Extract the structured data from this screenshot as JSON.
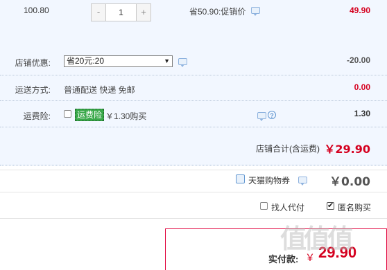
{
  "item": {
    "unit_price": "100.80",
    "quantity": "1",
    "minus": "-",
    "plus": "+",
    "promo_text": "省50.90:促销价",
    "subtotal": "49.90"
  },
  "shop_discount": {
    "label": "店铺优惠:",
    "selected_option": "省20元:20",
    "dropdown_arrow": "▼",
    "amount": "-20.00"
  },
  "shipping": {
    "label": "运送方式:",
    "method": "普通配送 快递 免邮",
    "amount": "0.00"
  },
  "freight_insurance": {
    "label": "运费险:",
    "tag": "运费险",
    "price_text": "￥1.30购买",
    "help": "?",
    "amount": "1.30"
  },
  "shop_total": {
    "label": "店铺合计(含运费)",
    "amount": "￥29.90"
  },
  "coupon": {
    "label": "天猫购物券",
    "amount": "￥0.00"
  },
  "options": {
    "proxy_pay": "找人代付",
    "anonymous": "匿名购买"
  },
  "payment": {
    "label": "实付款:",
    "currency": "￥",
    "amount": "29.90"
  },
  "watermark": "值值值",
  "colors": {
    "accent_red": "#d5001f",
    "panel_blue": "#f2f7ff",
    "tag_green": "#39a84a"
  }
}
